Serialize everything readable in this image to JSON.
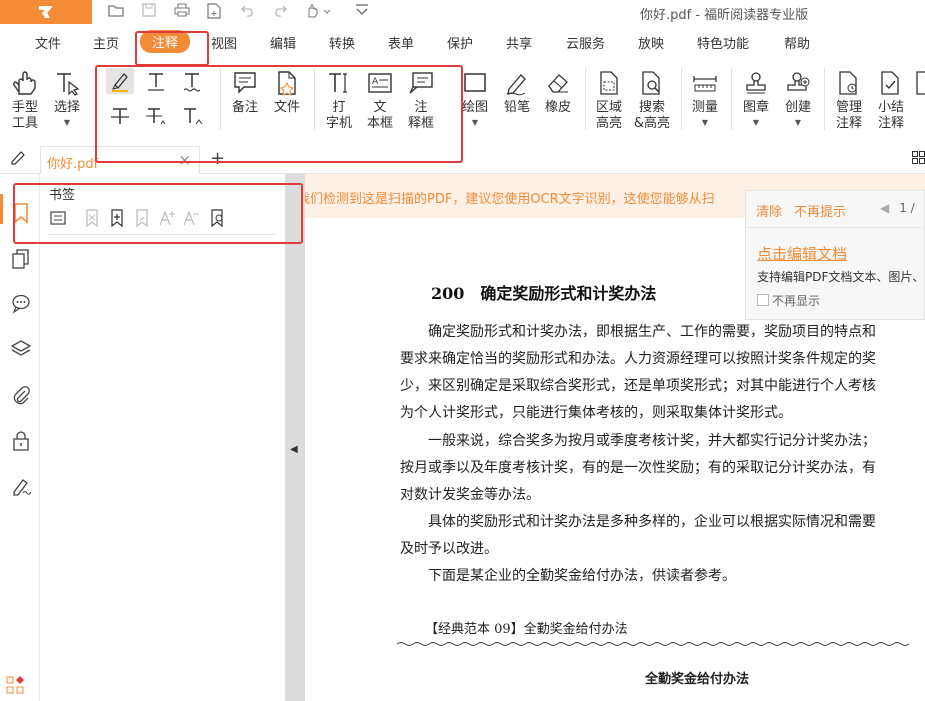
{
  "app": {
    "window_title": "你好.pdf - 福昕阅读器专业版",
    "accent_color": "#f48b36"
  },
  "quick_access": {
    "icons": [
      "open-folder-icon",
      "save-icon",
      "print-icon",
      "new-file-icon",
      "undo-icon",
      "redo-icon",
      "hand-dropdown-icon",
      "customize-icon"
    ]
  },
  "menu": {
    "items": [
      "文件",
      "主页",
      "注释",
      "视图",
      "编辑",
      "转换",
      "表单",
      "保护",
      "共享",
      "云服务",
      "放映",
      "特色功能",
      "帮助"
    ],
    "active": "注释"
  },
  "toolbar": {
    "hand": [
      "手型",
      "工具"
    ],
    "select": [
      "选择"
    ],
    "note": [
      "备注"
    ],
    "file": [
      "文件"
    ],
    "typewriter": [
      "打",
      "字机"
    ],
    "textbox": [
      "文",
      "本框"
    ],
    "callout": [
      "注",
      "释框"
    ],
    "drawing": [
      "绘图"
    ],
    "pencil": [
      "铅笔"
    ],
    "eraser": [
      "橡皮"
    ],
    "area_highlight": [
      "区域",
      "高亮"
    ],
    "search_highlight": [
      "搜索",
      "&高亮"
    ],
    "measure": [
      "测量"
    ],
    "stamp": [
      "图章"
    ],
    "create": [
      "创建"
    ],
    "manage_comments": [
      "管理",
      "注释"
    ],
    "summarize_comments": [
      "小结",
      "注释"
    ]
  },
  "tabs": {
    "doc_tab_label": "你好.pdf",
    "close_symbol": "×",
    "new_tab_symbol": "+"
  },
  "bookmark_panel": {
    "title": "书签"
  },
  "document": {
    "ocr_notice": "我们检测到这是扫描的PDF，建议您使用OCR文字识别，这使您能够从扫",
    "heading": "200　确定奖励形式和计奖办法",
    "paragraph_lines": [
      "　　确定奖励形式和计奖办法，即根据生产、工作的需要，奖励项目的特点和",
      "要求来确定恰当的奖励形式和办法。人力资源经理可以按照计奖条件规定的奖",
      "少，来区别确定是采取综合奖形式，还是单项奖形式；对其中能进行个人考核",
      "为个人计奖形式，只能进行集体考核的，则采取集体计奖形式。",
      "　　一般来说，综合奖多为按月或季度考核计奖，并大都实行记分计奖办法；",
      "按月或季以及年度考核计奖，有的是一次性奖励；有的采取记分计奖办法，有",
      "对数计发奖金等办法。",
      "　　具体的奖励形式和计奖办法是多种多样的，企业可以根据实际情况和需要",
      "及时予以改进。",
      "　　下面是某企业的全勤奖金给付办法，供读者参考。"
    ],
    "case_title": "【经典范本 09】全勤奖金给付办法",
    "sub_heading": "全勤奖金给付办法"
  },
  "popup": {
    "clear": "清除",
    "dont_remind": "不再提示",
    "pager": "1 /",
    "link": "点击编辑文档",
    "description": "支持编辑PDF文档文本、图片、",
    "checkbox_label": "不再显示"
  }
}
